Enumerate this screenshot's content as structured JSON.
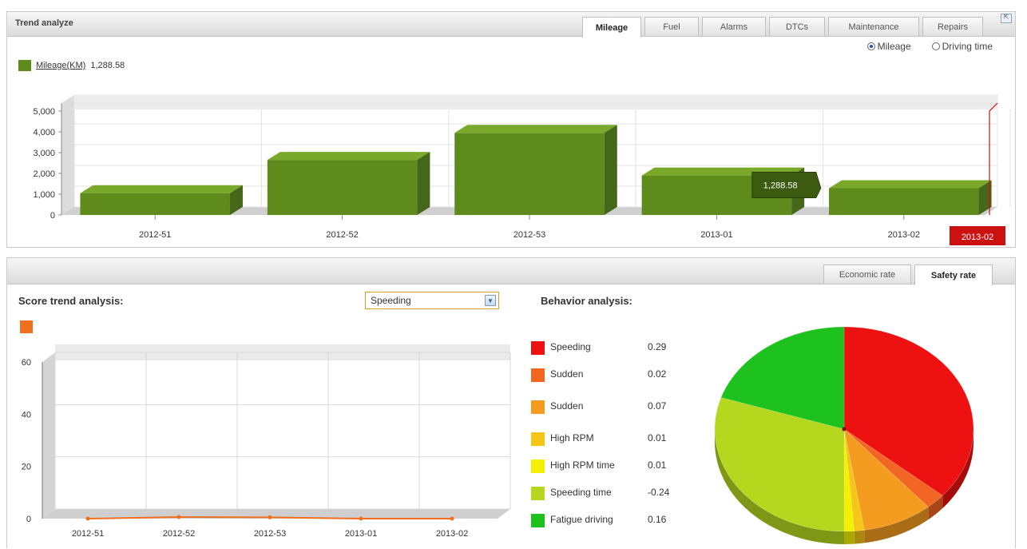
{
  "top": {
    "title": "Trend analyze",
    "tabs": [
      "Mileage",
      "Fuel",
      "Alarms",
      "DTCs",
      "Maintenance",
      "Repairs"
    ],
    "active_tab": "Mileage",
    "radios": [
      {
        "label": "Mileage",
        "checked": true
      },
      {
        "label": "Driving time",
        "checked": false
      }
    ],
    "legend": {
      "label": "Mileage(KM)",
      "value": "1,288.58"
    },
    "tooltip": "1,288.58",
    "highlight_label": "2013-02"
  },
  "chart_data": [
    {
      "type": "bar",
      "categories": [
        "2012-51",
        "2012-52",
        "2012-53",
        "2013-01",
        "2013-02"
      ],
      "series": [
        {
          "name": "Mileage(KM)",
          "values": [
            1050,
            2650,
            3950,
            1900,
            1288.58
          ]
        }
      ],
      "ylim": [
        0,
        5000
      ],
      "yticks": [
        "0",
        "1,000",
        "2,000",
        "3,000",
        "4,000",
        "5,000"
      ],
      "colors": {
        "bar": "#5f8a1c",
        "highlight": "#cc1111"
      }
    },
    {
      "type": "line",
      "categories": [
        "2012-51",
        "2012-52",
        "2012-53",
        "2013-01",
        "2013-02"
      ],
      "series": [
        {
          "values": [
            0,
            0.6,
            0.5,
            0,
            0
          ]
        }
      ],
      "ylim": [
        0,
        60
      ],
      "yticks": [
        "0",
        "20",
        "40",
        "60"
      ],
      "colors": {
        "line": "#f07020"
      }
    },
    {
      "type": "pie",
      "labels": [
        "Speeding",
        "Sudden",
        "Sudden",
        "High RPM",
        "High RPM time",
        "Speeding time",
        "Fatigue driving"
      ],
      "values": [
        0.29,
        0.02,
        0.07,
        0.01,
        0.01,
        -0.24,
        0.16
      ],
      "colors": [
        "#ee1111",
        "#f26522",
        "#f39c1f",
        "#f5c518",
        "#f4f000",
        "#b5d81e",
        "#1ec21e"
      ]
    }
  ],
  "bottom": {
    "tabs": [
      "Economic rate",
      "Safety rate"
    ],
    "active_tab": "Safety rate",
    "score_title": "Score trend analysis:",
    "select_value": "Speeding",
    "behavior_title": "Behavior analysis:",
    "behavior": [
      {
        "label": "Speeding",
        "value": "0.29",
        "color": "#ee1111"
      },
      {
        "label": "Sudden",
        "value": "0.02",
        "color": "#f26522"
      },
      {
        "label": "Sudden",
        "value": "0.07",
        "color": "#f39c1f"
      },
      {
        "label": "High RPM",
        "value": "0.01",
        "color": "#f5c518"
      },
      {
        "label": "High RPM time",
        "value": "0.01",
        "color": "#f4f000"
      },
      {
        "label": "Speeding time",
        "value": "-0.24",
        "color": "#b5d81e"
      },
      {
        "label": "Fatigue driving",
        "value": "0.16",
        "color": "#1ec21e"
      }
    ]
  }
}
